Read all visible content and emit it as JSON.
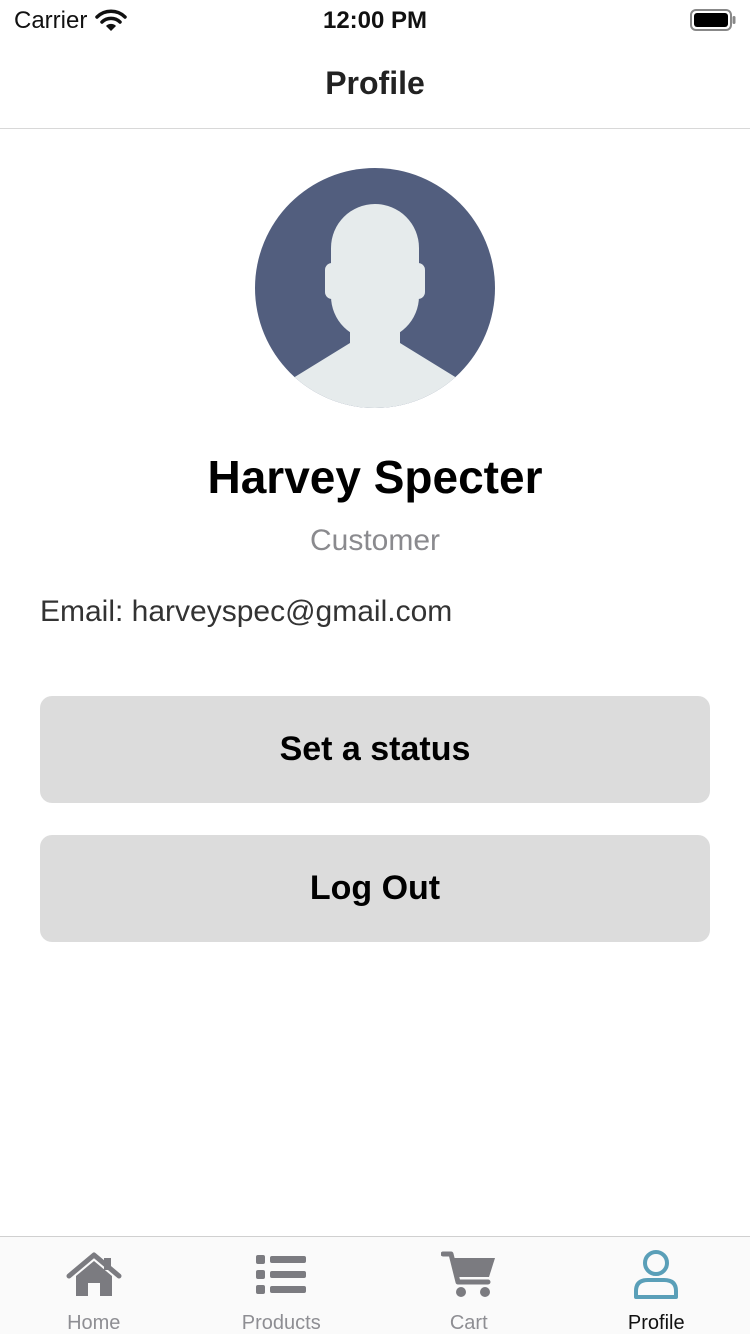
{
  "status_bar": {
    "carrier": "Carrier",
    "time": "12:00 PM"
  },
  "header": {
    "title": "Profile"
  },
  "profile": {
    "name": "Harvey Specter",
    "role": "Customer",
    "email": "Email: harveyspec@gmail.com",
    "avatar_icon": "default-user-silhouette"
  },
  "actions": {
    "set_status_label": "Set a status",
    "logout_label": "Log Out"
  },
  "tabs": [
    {
      "label": "Home",
      "icon": "home-icon",
      "active": false
    },
    {
      "label": "Products",
      "icon": "list-icon",
      "active": false
    },
    {
      "label": "Cart",
      "icon": "cart-icon",
      "active": false
    },
    {
      "label": "Profile",
      "icon": "user-icon",
      "active": true
    }
  ],
  "colors": {
    "accent": "#5a9fb8",
    "avatar_bg": "#525e7e",
    "button_bg": "#dcdcdc",
    "inactive_tab": "#7b7b80"
  }
}
